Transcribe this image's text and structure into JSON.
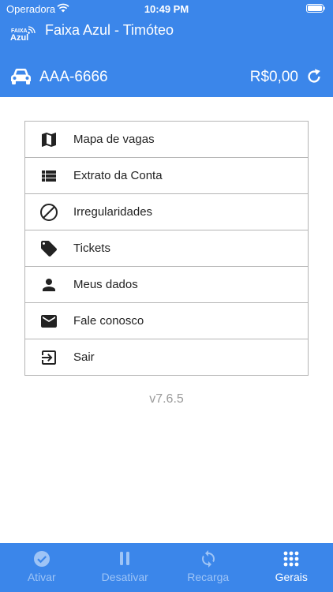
{
  "status": {
    "carrier": "Operadora",
    "time": "10:49 PM"
  },
  "header": {
    "logo_line1": "FAIXA",
    "logo_line2": "Azul",
    "title": "Faixa Azul - Timóteo",
    "plate": "AAA-6666",
    "balance": "R$0,00"
  },
  "menu": [
    {
      "label": "Mapa de vagas",
      "icon": "map-icon"
    },
    {
      "label": "Extrato da Conta",
      "icon": "list-icon"
    },
    {
      "label": "Irregularidades",
      "icon": "block-icon"
    },
    {
      "label": "Tickets",
      "icon": "tag-icon"
    },
    {
      "label": "Meus dados",
      "icon": "person-icon"
    },
    {
      "label": "Fale conosco",
      "icon": "mail-icon"
    },
    {
      "label": "Sair",
      "icon": "exit-icon"
    }
  ],
  "version": "v7.6.5",
  "tabs": [
    {
      "label": "Ativar",
      "icon": "check-circle-icon",
      "active": false
    },
    {
      "label": "Desativar",
      "icon": "pause-icon",
      "active": false
    },
    {
      "label": "Recarga",
      "icon": "sync-icon",
      "active": false
    },
    {
      "label": "Gerais",
      "icon": "grid-icon",
      "active": true
    }
  ],
  "colors": {
    "primary": "#3b86ea",
    "tab_inactive": "#9ec4f6",
    "border": "#b5b5b5",
    "version_text": "#9a9a9a"
  }
}
